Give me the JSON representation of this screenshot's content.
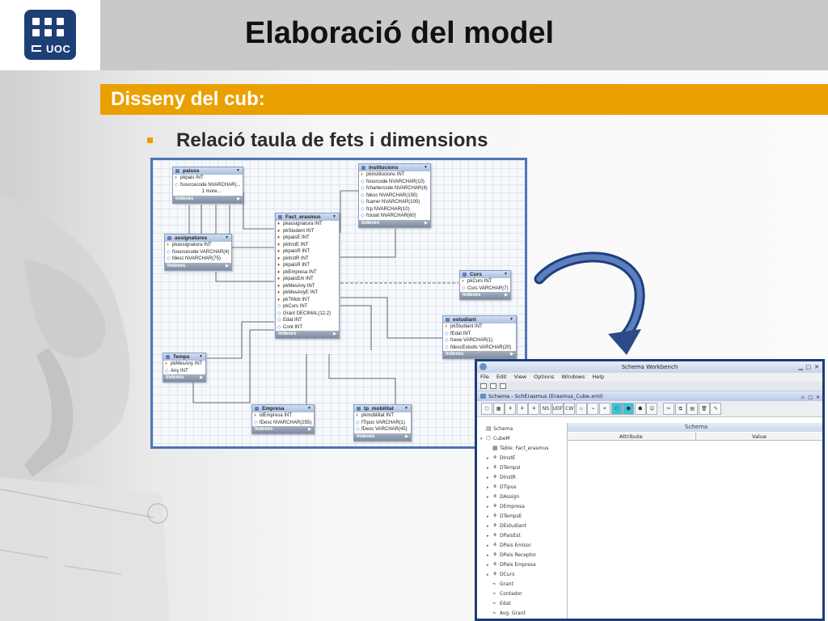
{
  "slide": {
    "logo_text": "UOC",
    "title": "Elaboració del model",
    "section": "Disseny del cub:",
    "bullet": "Relació taula de fets i dimensions"
  },
  "colors": {
    "title_bar": "#c9c9c9",
    "accent": "#e9a000",
    "logo_bg": "#1e3f76",
    "frame": "#4f74b5",
    "arrow": "#2b4a86"
  },
  "er_diagram": {
    "footer_label": "Indexes",
    "tables": [
      {
        "name": "paisos",
        "columns": [
          {
            "key": "pk",
            "text": "pkpais INT"
          },
          {
            "key": "col",
            "text": "fsourcecode NVARCHAR(..."
          },
          {
            "key": "none",
            "text": "1 more..."
          }
        ]
      },
      {
        "name": "institucions",
        "columns": [
          {
            "key": "pk",
            "text": "pkinstitucions INT"
          },
          {
            "key": "col",
            "text": "fsourcode NVARCHAR(10)"
          },
          {
            "key": "col",
            "text": "fchartercode NVARCHAR(4)"
          },
          {
            "key": "col",
            "text": "fdesc NVARCHAR(150)"
          },
          {
            "key": "col",
            "text": "fcarrer NVARCHAR(100)"
          },
          {
            "key": "col",
            "text": "fcp NVARCHAR(10)"
          },
          {
            "key": "col",
            "text": "fciutat NVARCHAR(60)"
          }
        ]
      },
      {
        "name": "Fact_erasmus",
        "columns": [
          {
            "key": "fk",
            "text": "pkassignatura INT"
          },
          {
            "key": "fk",
            "text": "pkStudent INT"
          },
          {
            "key": "fk",
            "text": "pkpaisE INT"
          },
          {
            "key": "fk",
            "text": "pkInstE INT"
          },
          {
            "key": "fk",
            "text": "pkpaisR INT"
          },
          {
            "key": "fk",
            "text": "pkInstR INT"
          },
          {
            "key": "fk",
            "text": "pkpaisR INT"
          },
          {
            "key": "fk",
            "text": "pkEmpresa INT"
          },
          {
            "key": "fk",
            "text": "pkpaisEm INT"
          },
          {
            "key": "fk",
            "text": "pkMesAny INT"
          },
          {
            "key": "fk",
            "text": "pkMesAnyE INT"
          },
          {
            "key": "fk",
            "text": "pkTMob INT"
          },
          {
            "key": "col",
            "text": "pkCurs INT"
          },
          {
            "key": "col",
            "text": "Grant DECIMAL(12,2)"
          },
          {
            "key": "col",
            "text": "Edat INT"
          },
          {
            "key": "col",
            "text": "Cont INT"
          }
        ]
      },
      {
        "name": "assignatures",
        "columns": [
          {
            "key": "pk",
            "text": "pkassignatura INT"
          },
          {
            "key": "col",
            "text": "fsourcecode VARCHAR(4)"
          },
          {
            "key": "col",
            "text": "fdesc NVARCHAR(75)"
          }
        ]
      },
      {
        "name": "Curs",
        "columns": [
          {
            "key": "pk",
            "text": "pkCurs INT"
          },
          {
            "key": "col",
            "text": "Curs VARCHAR(7)"
          }
        ]
      },
      {
        "name": "estudiant",
        "columns": [
          {
            "key": "pk",
            "text": "pkStudiant INT"
          },
          {
            "key": "col",
            "text": "fEdat INT"
          },
          {
            "key": "col",
            "text": "fsexe VARCHAR(1)"
          },
          {
            "key": "col",
            "text": "fdescEstudis VARCHAR(20)"
          }
        ]
      },
      {
        "name": "Temps",
        "columns": [
          {
            "key": "pk",
            "text": "pkMesAny INT"
          },
          {
            "key": "col",
            "text": "Any INT"
          }
        ]
      },
      {
        "name": "Empresa",
        "columns": [
          {
            "key": "pk",
            "text": "idEmpresa INT"
          },
          {
            "key": "col",
            "text": "fDesc NVARCHAR(255)"
          }
        ]
      },
      {
        "name": "tp_mobilitat",
        "columns": [
          {
            "key": "pk",
            "text": "pkmobilitat INT"
          },
          {
            "key": "col",
            "text": "fTipus VARCHAR(1)"
          },
          {
            "key": "col",
            "text": "fDesc VARCHAR(45)"
          }
        ]
      }
    ]
  },
  "schema_workbench": {
    "window_title": "Schema Workbench",
    "menu": [
      "File",
      "Edit",
      "View",
      "Options",
      "Windows",
      "Help"
    ],
    "document_title": "Schema - SchErasmus (Erasmus_Cube.xml)",
    "toolbar": [
      {
        "label": "⬡",
        "icon": "cube-icon"
      },
      {
        "label": "▦",
        "icon": "table-icon"
      },
      {
        "label": "⚘",
        "icon": "dimension-icon"
      },
      {
        "label": "⚘",
        "icon": "dimension-usage-icon"
      },
      {
        "label": "⚘",
        "icon": "hierarchy-icon"
      },
      {
        "label": "NS",
        "icon": "named-set-icon"
      },
      {
        "label": "UDF",
        "icon": "udf-icon"
      },
      {
        "label": "CW",
        "icon": "cube-wizard-icon"
      },
      {
        "label": "⬦",
        "icon": "level-icon"
      },
      {
        "label": "⌁",
        "icon": "measure-icon"
      },
      {
        "label": "⌖",
        "icon": "calc-member-icon"
      },
      {
        "label": "⬡",
        "icon": "virtual-cube-icon"
      },
      {
        "label": "⬢",
        "icon": "virtual-dimension-icon"
      },
      {
        "label": "⬢",
        "icon": "virtual-measure-icon"
      },
      {
        "label": "☺",
        "icon": "role-icon"
      },
      {
        "label": "✂",
        "icon": "cut-icon"
      },
      {
        "label": "⧉",
        "icon": "copy-icon"
      },
      {
        "label": "▤",
        "icon": "paste-icon"
      },
      {
        "label": "🗑",
        "icon": "delete-icon"
      },
      {
        "label": "✎",
        "icon": "edit-icon"
      }
    ],
    "tree": [
      {
        "label": "Schema",
        "icon": "schema-icon",
        "depth": 0,
        "twisty": ""
      },
      {
        "label": "CubeM",
        "icon": "cube-icon",
        "depth": 0,
        "twisty": "▾"
      },
      {
        "label": "Table: Fact_erasmus",
        "icon": "table-icon",
        "depth": 1,
        "twisty": ""
      },
      {
        "label": "DInstE",
        "icon": "dimension-icon",
        "depth": 1,
        "twisty": "▸"
      },
      {
        "label": "DTempsI",
        "icon": "dimension-icon",
        "depth": 1,
        "twisty": "▸"
      },
      {
        "label": "DInstR",
        "icon": "dimension-icon",
        "depth": 1,
        "twisty": "▸"
      },
      {
        "label": "DTipus",
        "icon": "dimension-icon",
        "depth": 1,
        "twisty": "▸"
      },
      {
        "label": "DAssign",
        "icon": "dimension-icon",
        "depth": 1,
        "twisty": "▸"
      },
      {
        "label": "DEmpresa",
        "icon": "dimension-icon",
        "depth": 1,
        "twisty": "▸"
      },
      {
        "label": "DTempsE",
        "icon": "dimension-icon",
        "depth": 1,
        "twisty": "▸"
      },
      {
        "label": "DEstudiant",
        "icon": "dimension-icon",
        "depth": 1,
        "twisty": "▸"
      },
      {
        "label": "DPaisEst",
        "icon": "dimension-icon",
        "depth": 1,
        "twisty": "▸"
      },
      {
        "label": "DPais Emisor",
        "icon": "dimension-icon",
        "depth": 1,
        "twisty": "▸"
      },
      {
        "label": "DPais Receptor",
        "icon": "dimension-icon",
        "depth": 1,
        "twisty": "▸"
      },
      {
        "label": "DPais Empresa",
        "icon": "dimension-icon",
        "depth": 1,
        "twisty": "▸"
      },
      {
        "label": "DCurs",
        "icon": "dimension-icon",
        "depth": 1,
        "twisty": "▸"
      },
      {
        "label": "Grant",
        "icon": "measure-icon",
        "depth": 1,
        "twisty": ""
      },
      {
        "label": "Contador",
        "icon": "measure-icon",
        "depth": 1,
        "twisty": ""
      },
      {
        "label": "Edat",
        "icon": "measure-icon",
        "depth": 1,
        "twisty": ""
      },
      {
        "label": "Avg. Grant",
        "icon": "measure-icon",
        "depth": 1,
        "twisty": ""
      }
    ],
    "panel_title": "Schema",
    "columns": [
      "Attribute",
      "Value"
    ]
  }
}
